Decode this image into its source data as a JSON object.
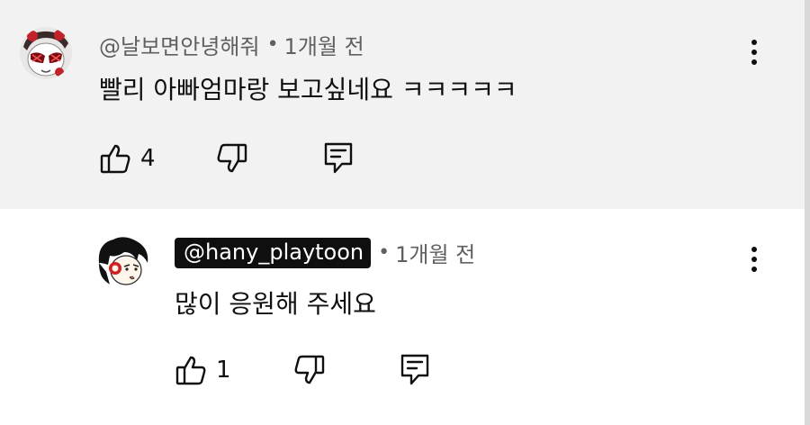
{
  "comment": {
    "handle": "@날보면안녕해줘",
    "time": "1개월 전",
    "text": "빨리 아빠엄마랑 보고싶네요 ㅋㅋㅋㅋㅋ",
    "likes": "4",
    "background": "#f2f2f2"
  },
  "reply": {
    "handle": "@hany_playtoon",
    "time": "1개월 전",
    "text": "많이 응원해 주세요",
    "likes": "1",
    "handle_badge_color": "#0f0f0f"
  },
  "icons": {
    "like": "thumbs-up-icon",
    "dislike": "thumbs-down-icon",
    "reply": "reply-comment-icon",
    "menu": "more-vertical-icon"
  }
}
